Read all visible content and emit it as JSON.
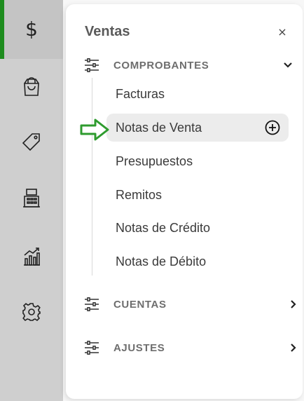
{
  "rail": {
    "items": [
      {
        "icon": "dollar-icon",
        "glyph": "$",
        "active": true
      },
      {
        "icon": "shopping-bag-icon",
        "active": false
      },
      {
        "icon": "tag-icon",
        "active": false
      },
      {
        "icon": "cash-register-icon",
        "active": false
      },
      {
        "icon": "bar-chart-icon",
        "active": false
      },
      {
        "icon": "gear-icon",
        "active": false
      }
    ],
    "accent_color": "#1e8c1e"
  },
  "panel": {
    "title": "Ventas",
    "close_label": "×",
    "sections": [
      {
        "label": "COMPROBANTES",
        "icon": "sliders-icon",
        "expanded": true,
        "items": [
          {
            "label": "Facturas"
          },
          {
            "label": "Notas de Venta",
            "active": true
          },
          {
            "label": "Presupuestos"
          },
          {
            "label": "Remitos"
          },
          {
            "label": "Notas de Crédito"
          },
          {
            "label": "Notas de Débito"
          }
        ]
      },
      {
        "label": "CUENTAS",
        "icon": "sliders-icon",
        "expanded": false
      },
      {
        "label": "AJUSTES",
        "icon": "sliders-icon",
        "expanded": false
      }
    ]
  },
  "pointer_arrow_color": "#2e9b2e"
}
